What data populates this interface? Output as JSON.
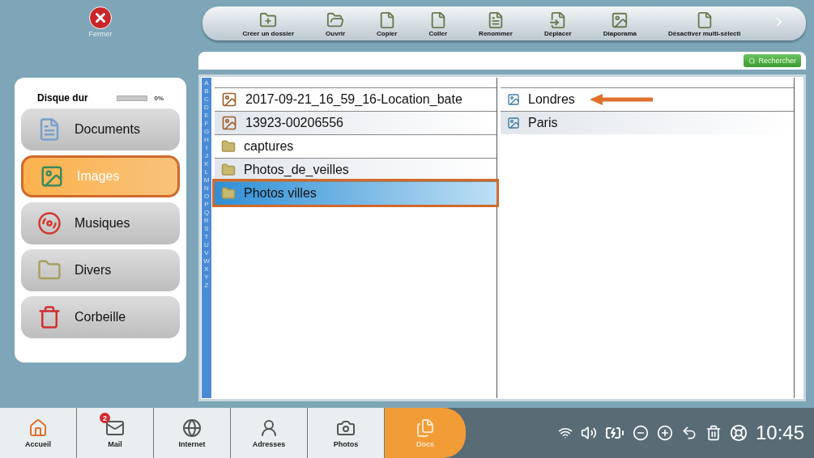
{
  "close_button": {
    "label": "Fermer"
  },
  "toolbar": [
    {
      "label": "Créer un dossier"
    },
    {
      "label": "Ouvrir"
    },
    {
      "label": "Copier"
    },
    {
      "label": "Coller"
    },
    {
      "label": "Renommer"
    },
    {
      "label": "Déplacer"
    },
    {
      "label": "Diaporama"
    },
    {
      "label": "Désactiver multi-sélecti"
    }
  ],
  "search": {
    "button": "Rechercher"
  },
  "sidebar": {
    "disk": {
      "label": "Disque dur",
      "level": 0,
      "reading": "0%"
    },
    "items": [
      {
        "label": "Documents",
        "selected": false
      },
      {
        "label": "Images",
        "selected": true
      },
      {
        "label": "Musiques",
        "selected": false
      },
      {
        "label": "Divers",
        "selected": false
      },
      {
        "label": "Corbeille",
        "selected": false
      }
    ]
  },
  "alphabet": [
    "A",
    "B",
    "C",
    "D",
    "E",
    "F",
    "G",
    "H",
    "I",
    "J",
    "K",
    "L",
    "M",
    "N",
    "O",
    "P",
    "Q",
    "R",
    "S",
    "T",
    "U",
    "V",
    "W",
    "X",
    "Y",
    "Z"
  ],
  "columns": [
    [
      {
        "name": "2017-09-21_16_59_16-Location_bate",
        "kind": "photo",
        "selected": false
      },
      {
        "name": "13923-00206556",
        "kind": "photo",
        "selected": false
      },
      {
        "name": "captures",
        "kind": "folder",
        "selected": false
      },
      {
        "name": "Photos_de_veilles",
        "kind": "folder",
        "selected": false
      },
      {
        "name": "Photos villes",
        "kind": "folder",
        "selected": true
      }
    ],
    [
      {
        "name": "Londres",
        "kind": "image",
        "selected": false
      },
      {
        "name": "Paris",
        "kind": "image",
        "selected": false
      }
    ]
  ],
  "taskbar": [
    {
      "label": "Accueil",
      "selected": false
    },
    {
      "label": "Mail",
      "selected": false,
      "badge": "2"
    },
    {
      "label": "Internet",
      "selected": false
    },
    {
      "label": "Adresses",
      "selected": false
    },
    {
      "label": "Photos",
      "selected": false
    },
    {
      "label": "Docs",
      "selected": true
    }
  ],
  "clock": "10:45"
}
